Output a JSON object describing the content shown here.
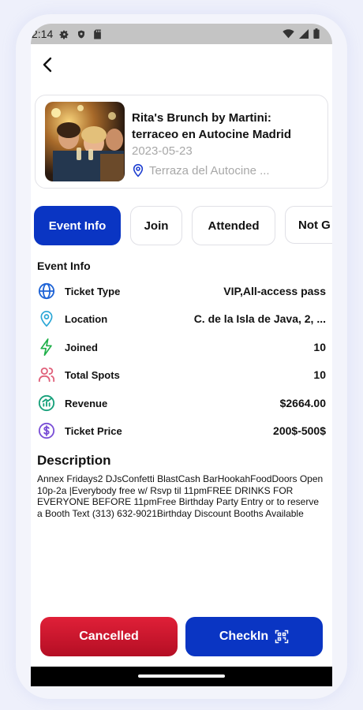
{
  "status_bar": {
    "time": "2:14"
  },
  "event": {
    "title": "Rita's Brunch by Martini: terraceo en Autocine Madrid",
    "date": "2023-05-23",
    "location": "Terraza del Autocine ..."
  },
  "tabs": [
    {
      "label": "Event Info",
      "active": true
    },
    {
      "label": "Join",
      "active": false
    },
    {
      "label": "Attended",
      "active": false
    },
    {
      "label": "Not G",
      "active": false
    }
  ],
  "section_title": "Event Info",
  "info_rows": [
    {
      "icon": "globe-icon",
      "label": "Ticket Type",
      "value": "VIP,All-access pass",
      "color": "#1e63d6"
    },
    {
      "icon": "location-pin-icon",
      "label": "Location",
      "value": "C. de la Isla de Java, 2, ...",
      "color": "#2aa6d6"
    },
    {
      "icon": "lightning-icon",
      "label": "Joined",
      "value": "10",
      "color": "#20b04a"
    },
    {
      "icon": "users-icon",
      "label": "Total Spots",
      "value": "10",
      "color": "#e0607a"
    },
    {
      "icon": "revenue-chart-icon",
      "label": "Revenue",
      "value": "$2664.00",
      "color": "#16a07a"
    },
    {
      "icon": "dollar-circle-icon",
      "label": "Ticket Price",
      "value": "200$-500$",
      "color": "#7a4fd6"
    }
  ],
  "description": {
    "title": "Description",
    "text": "Annex Fridays2 DJsConfetti BlastCash BarHookahFoodDoors Open 10p-2a |Everybody free w/ Rsvp til 11pmFREE DRINKS FOR EVERYONE BEFORE 11pmFree Birthday Party Entry or to reserve a Booth Text (313) 632-9021Birthday Discount Booths Available"
  },
  "buttons": {
    "cancel_label": "Cancelled",
    "checkin_label": "CheckIn"
  },
  "colors": {
    "primary": "#0a35c3",
    "danger": "#d0182e"
  }
}
